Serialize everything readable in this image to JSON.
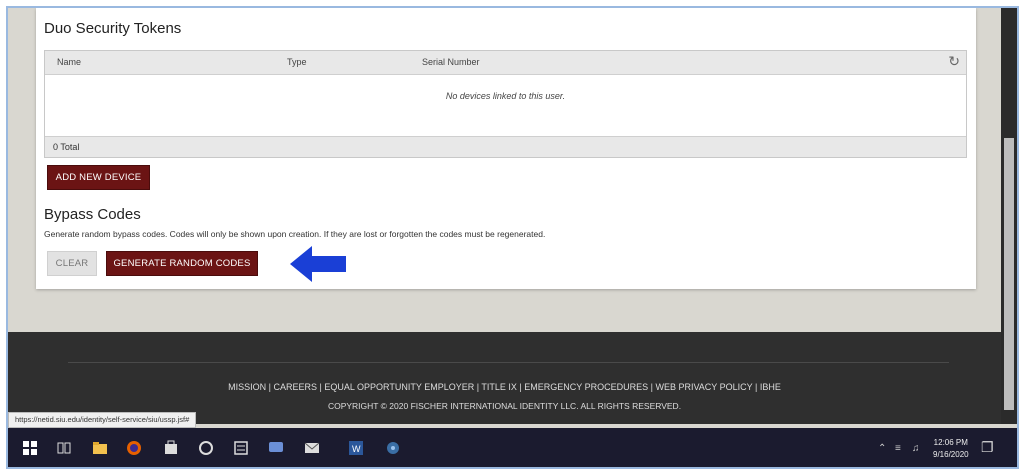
{
  "tokens": {
    "title": "Duo Security Tokens",
    "columns": [
      "Name",
      "Type",
      "Serial Number"
    ],
    "empty_message": "No devices linked to this user.",
    "total": "0 Total",
    "add_button": "ADD NEW DEVICE"
  },
  "bypass": {
    "title": "Bypass Codes",
    "description": "Generate random bypass codes. Codes will only be shown upon creation. If they are lost or forgotten the codes must be regenerated.",
    "clear_button": "CLEAR",
    "generate_button": "GENERATE RANDOM CODES"
  },
  "footer": {
    "links": "MISSION | CAREERS | EQUAL OPPORTUNITY EMPLOYER | TITLE IX | EMERGENCY PROCEDURES | WEB PRIVACY POLICY | IBHE",
    "copyright": "COPYRIGHT © 2020 FISCHER INTERNATIONAL IDENTITY LLC. ALL RIGHTS RESERVED."
  },
  "status_url": "https://netid.siu.edu/identity/self-service/siu/ussp.jsf#",
  "taskbar": {
    "time": "12:06 PM",
    "date": "9/16/2020",
    "icons": [
      "windows-start-icon",
      "task-view-icon",
      "file-explorer-icon",
      "firefox-icon",
      "store-icon",
      "support-icon",
      "app-icon",
      "chat-icon",
      "mail-icon",
      "word-icon",
      "media-icon"
    ]
  },
  "colors": {
    "accent": "#6b1414",
    "arrow": "#1a3fd6",
    "footer": "#2f2f2f"
  }
}
